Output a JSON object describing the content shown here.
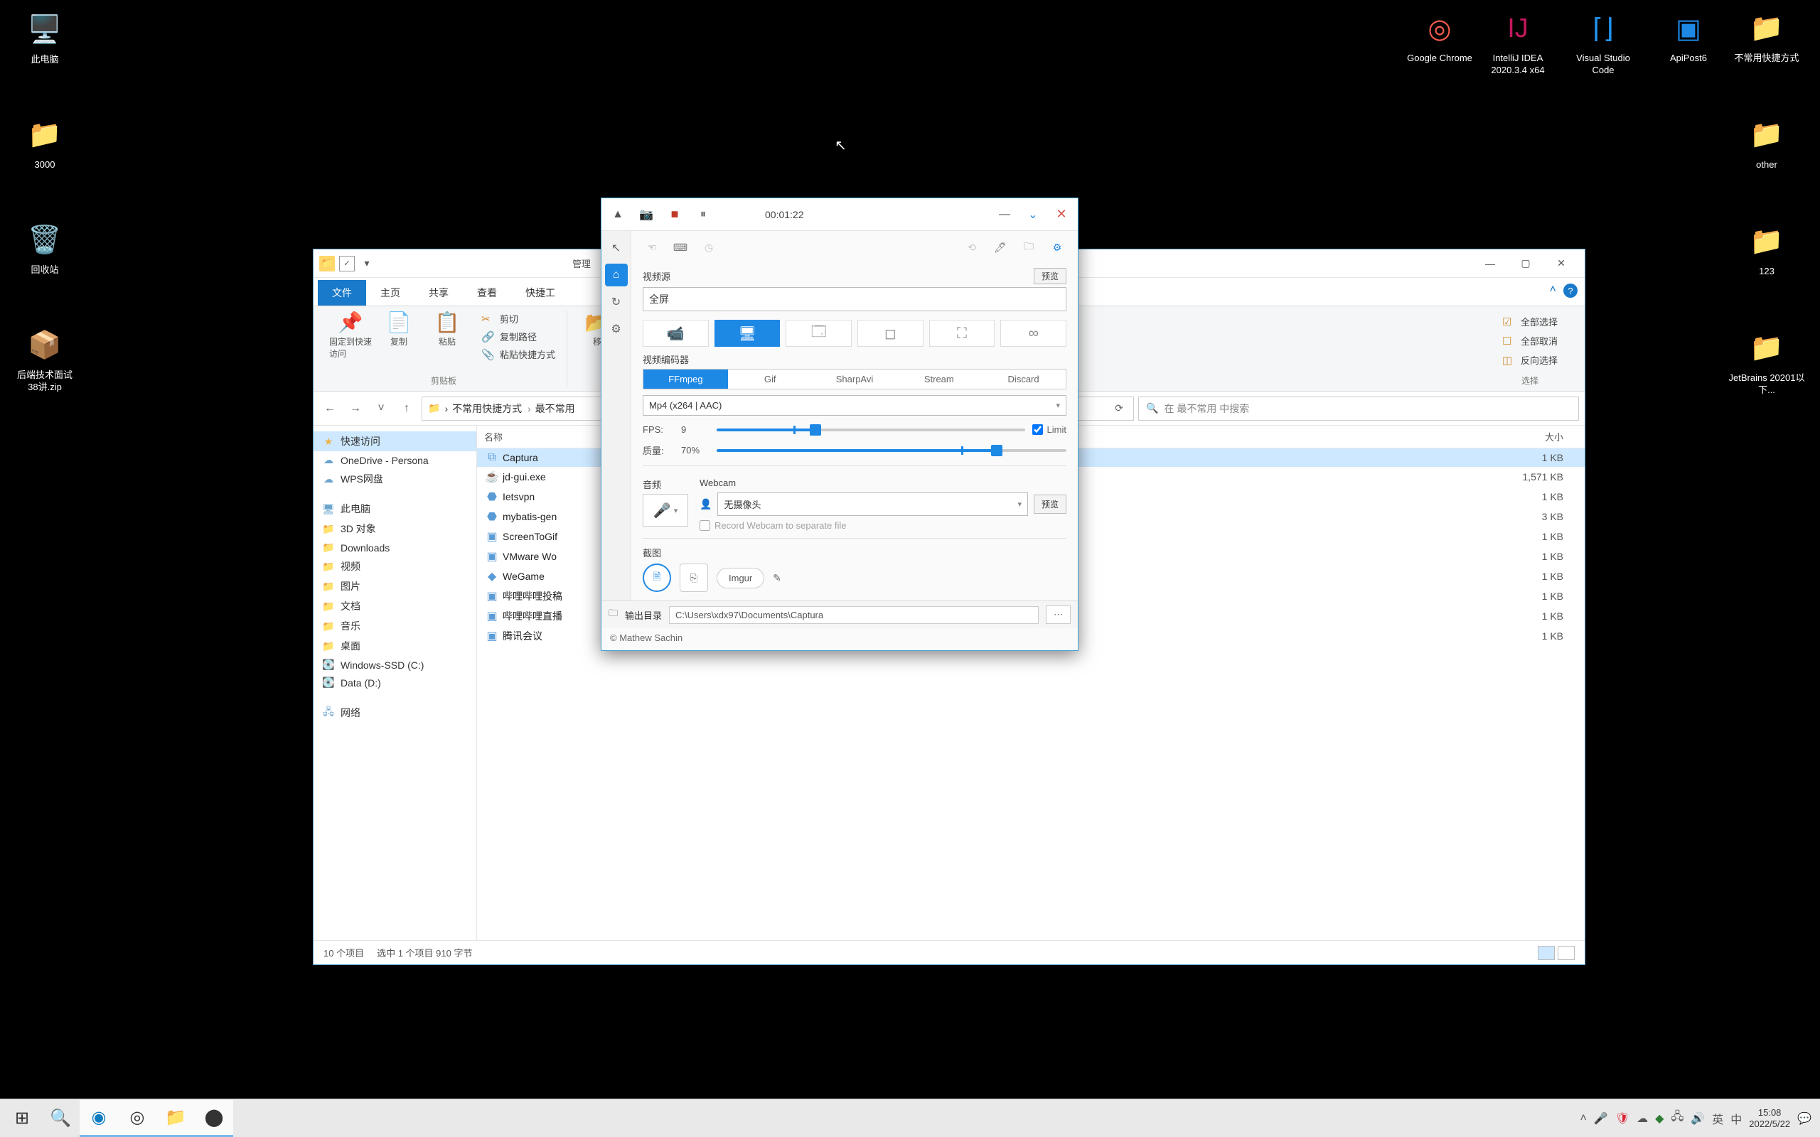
{
  "desktop": {
    "left": [
      {
        "label": "此电脑",
        "icon": "🖥️",
        "color": "#2a6fb0"
      },
      {
        "label": "3000",
        "icon": "📁",
        "color": "#ffd76b"
      },
      {
        "label": "回收站",
        "icon": "🗑️",
        "color": "#d0d6da"
      },
      {
        "label": "后端技术面试38讲.zip",
        "icon": "📦",
        "color": "#3aa0e0"
      }
    ],
    "right": [
      {
        "label": "Google Chrome",
        "icon": "◎",
        "color": "#ef5b4c"
      },
      {
        "label": "IntelliJ IDEA 2020.3.4 x64",
        "icon": "IJ",
        "color": "#c2185b"
      },
      {
        "label": "Visual Studio Code",
        "icon": "⌈⌋",
        "color": "#2196f3"
      },
      {
        "label": "ApiPost6",
        "icon": "▣",
        "color": "#1e88e5"
      },
      {
        "label": "不常用快捷方式",
        "icon": "📁",
        "color": "#ffd76b"
      },
      {
        "label": "other",
        "icon": "📁",
        "color": "#ffd76b"
      },
      {
        "label": "123",
        "icon": "📁",
        "color": "#ffd76b"
      },
      {
        "label": "JetBrains 20201以下...",
        "icon": "📁",
        "color": "#ffd76b"
      }
    ]
  },
  "explorer": {
    "manage_tab": "管理",
    "ribbon_tabs": [
      "文件",
      "主页",
      "共享",
      "查看",
      "快捷工"
    ],
    "ribbon": {
      "pin": "固定到快速访问",
      "copy": "复制",
      "paste": "粘贴",
      "cut": "剪切",
      "copypath": "复制路径",
      "pasteshortcut": "粘贴快捷方式",
      "move": "移",
      "groupname": "剪贴板",
      "sel_all": "全部选择",
      "sel_none": "全部取消",
      "sel_inv": "反向选择",
      "sel_group": "选择"
    },
    "breadcrumbs": [
      "不常用快捷方式",
      "最不常用"
    ],
    "search_placeholder": "在 最不常用 中搜索",
    "col_name": "名称",
    "col_size": "大小",
    "sidebar": [
      {
        "label": "快速访问",
        "ic": "★",
        "sel": true,
        "cls": ""
      },
      {
        "label": "OneDrive - Persona",
        "ic": "☁",
        "cls": "drive"
      },
      {
        "label": "WPS网盘",
        "ic": "☁",
        "cls": "drive"
      },
      {
        "label": "",
        "spacer": true
      },
      {
        "label": "此电脑",
        "ic": "🖥",
        "cls": "drive"
      },
      {
        "label": "3D 对象",
        "ic": "📁",
        "cls": ""
      },
      {
        "label": "Downloads",
        "ic": "📁",
        "cls": ""
      },
      {
        "label": "视频",
        "ic": "📁",
        "cls": ""
      },
      {
        "label": "图片",
        "ic": "📁",
        "cls": ""
      },
      {
        "label": "文档",
        "ic": "📁",
        "cls": ""
      },
      {
        "label": "音乐",
        "ic": "📁",
        "cls": ""
      },
      {
        "label": "桌面",
        "ic": "📁",
        "cls": ""
      },
      {
        "label": "Windows-SSD (C:)",
        "ic": "💽",
        "cls": "drive"
      },
      {
        "label": "Data (D:)",
        "ic": "💽",
        "cls": "drive"
      },
      {
        "label": "",
        "spacer": true
      },
      {
        "label": "网络",
        "ic": "🖧",
        "cls": "drive"
      }
    ],
    "files": [
      {
        "name": "Captura",
        "size": "1 KB",
        "ic": "⧉",
        "sel": true
      },
      {
        "name": "jd-gui.exe",
        "size": "1,571 KB",
        "ic": "☕"
      },
      {
        "name": "Ietsvpn",
        "size": "1 KB",
        "ic": "⬣"
      },
      {
        "name": "mybatis-gen",
        "size": "3 KB",
        "ic": "⬣"
      },
      {
        "name": "ScreenToGif",
        "size": "1 KB",
        "ic": "▣"
      },
      {
        "name": "VMware Wo",
        "size": "1 KB",
        "ic": "▣"
      },
      {
        "name": "WeGame",
        "size": "1 KB",
        "ic": "◆"
      },
      {
        "name": "哔哩哔哩投稿",
        "size": "1 KB",
        "ic": "▣"
      },
      {
        "name": "哔哩哔哩直播",
        "size": "1 KB",
        "ic": "▣"
      },
      {
        "name": "腾讯会议",
        "size": "1 KB",
        "ic": "▣"
      }
    ],
    "status_count": "10 个项目",
    "status_sel": "选中 1 个项目 910 字节"
  },
  "captura": {
    "time": "00:01:22",
    "video_src_label": "视频源",
    "preview": "预览",
    "video_src_value": "全屏",
    "encoder_label": "视频编码器",
    "enc_tabs": [
      "FFmpeg",
      "Gif",
      "SharpAvi",
      "Stream",
      "Discard"
    ],
    "enc_value": "Mp4 (x264 | AAC)",
    "fps_label": "FPS:",
    "fps_value": "9",
    "limit": "Limit",
    "qual_label": "质量:",
    "qual_value": "70%",
    "audio_label": "音频",
    "webcam_label": "Webcam",
    "webcam_value": "无摄像头",
    "webcam_sep": "Record Webcam to separate file",
    "shot_label": "截图",
    "imgur": "Imgur",
    "out_label": "输出目录",
    "out_path": "C:\\Users\\xdx97\\Documents\\Captura",
    "credit": "© Mathew Sachin"
  },
  "taskbar": {
    "tray_lang": "英",
    "tray_ime": "中",
    "clock_time": "15:08",
    "clock_date": "2022/5/22"
  }
}
